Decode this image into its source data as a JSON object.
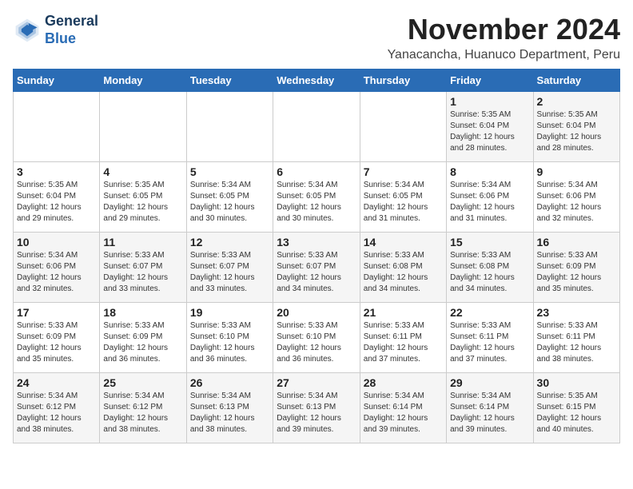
{
  "header": {
    "logo_line1": "General",
    "logo_line2": "Blue",
    "month": "November 2024",
    "location": "Yanacancha, Huanuco Department, Peru"
  },
  "weekdays": [
    "Sunday",
    "Monday",
    "Tuesday",
    "Wednesday",
    "Thursday",
    "Friday",
    "Saturday"
  ],
  "weeks": [
    [
      {
        "day": "",
        "info": ""
      },
      {
        "day": "",
        "info": ""
      },
      {
        "day": "",
        "info": ""
      },
      {
        "day": "",
        "info": ""
      },
      {
        "day": "",
        "info": ""
      },
      {
        "day": "1",
        "info": "Sunrise: 5:35 AM\nSunset: 6:04 PM\nDaylight: 12 hours and 28 minutes."
      },
      {
        "day": "2",
        "info": "Sunrise: 5:35 AM\nSunset: 6:04 PM\nDaylight: 12 hours and 28 minutes."
      }
    ],
    [
      {
        "day": "3",
        "info": "Sunrise: 5:35 AM\nSunset: 6:04 PM\nDaylight: 12 hours and 29 minutes."
      },
      {
        "day": "4",
        "info": "Sunrise: 5:35 AM\nSunset: 6:05 PM\nDaylight: 12 hours and 29 minutes."
      },
      {
        "day": "5",
        "info": "Sunrise: 5:34 AM\nSunset: 6:05 PM\nDaylight: 12 hours and 30 minutes."
      },
      {
        "day": "6",
        "info": "Sunrise: 5:34 AM\nSunset: 6:05 PM\nDaylight: 12 hours and 30 minutes."
      },
      {
        "day": "7",
        "info": "Sunrise: 5:34 AM\nSunset: 6:05 PM\nDaylight: 12 hours and 31 minutes."
      },
      {
        "day": "8",
        "info": "Sunrise: 5:34 AM\nSunset: 6:06 PM\nDaylight: 12 hours and 31 minutes."
      },
      {
        "day": "9",
        "info": "Sunrise: 5:34 AM\nSunset: 6:06 PM\nDaylight: 12 hours and 32 minutes."
      }
    ],
    [
      {
        "day": "10",
        "info": "Sunrise: 5:34 AM\nSunset: 6:06 PM\nDaylight: 12 hours and 32 minutes."
      },
      {
        "day": "11",
        "info": "Sunrise: 5:33 AM\nSunset: 6:07 PM\nDaylight: 12 hours and 33 minutes."
      },
      {
        "day": "12",
        "info": "Sunrise: 5:33 AM\nSunset: 6:07 PM\nDaylight: 12 hours and 33 minutes."
      },
      {
        "day": "13",
        "info": "Sunrise: 5:33 AM\nSunset: 6:07 PM\nDaylight: 12 hours and 34 minutes."
      },
      {
        "day": "14",
        "info": "Sunrise: 5:33 AM\nSunset: 6:08 PM\nDaylight: 12 hours and 34 minutes."
      },
      {
        "day": "15",
        "info": "Sunrise: 5:33 AM\nSunset: 6:08 PM\nDaylight: 12 hours and 34 minutes."
      },
      {
        "day": "16",
        "info": "Sunrise: 5:33 AM\nSunset: 6:09 PM\nDaylight: 12 hours and 35 minutes."
      }
    ],
    [
      {
        "day": "17",
        "info": "Sunrise: 5:33 AM\nSunset: 6:09 PM\nDaylight: 12 hours and 35 minutes."
      },
      {
        "day": "18",
        "info": "Sunrise: 5:33 AM\nSunset: 6:09 PM\nDaylight: 12 hours and 36 minutes."
      },
      {
        "day": "19",
        "info": "Sunrise: 5:33 AM\nSunset: 6:10 PM\nDaylight: 12 hours and 36 minutes."
      },
      {
        "day": "20",
        "info": "Sunrise: 5:33 AM\nSunset: 6:10 PM\nDaylight: 12 hours and 36 minutes."
      },
      {
        "day": "21",
        "info": "Sunrise: 5:33 AM\nSunset: 6:11 PM\nDaylight: 12 hours and 37 minutes."
      },
      {
        "day": "22",
        "info": "Sunrise: 5:33 AM\nSunset: 6:11 PM\nDaylight: 12 hours and 37 minutes."
      },
      {
        "day": "23",
        "info": "Sunrise: 5:33 AM\nSunset: 6:11 PM\nDaylight: 12 hours and 38 minutes."
      }
    ],
    [
      {
        "day": "24",
        "info": "Sunrise: 5:34 AM\nSunset: 6:12 PM\nDaylight: 12 hours and 38 minutes."
      },
      {
        "day": "25",
        "info": "Sunrise: 5:34 AM\nSunset: 6:12 PM\nDaylight: 12 hours and 38 minutes."
      },
      {
        "day": "26",
        "info": "Sunrise: 5:34 AM\nSunset: 6:13 PM\nDaylight: 12 hours and 38 minutes."
      },
      {
        "day": "27",
        "info": "Sunrise: 5:34 AM\nSunset: 6:13 PM\nDaylight: 12 hours and 39 minutes."
      },
      {
        "day": "28",
        "info": "Sunrise: 5:34 AM\nSunset: 6:14 PM\nDaylight: 12 hours and 39 minutes."
      },
      {
        "day": "29",
        "info": "Sunrise: 5:34 AM\nSunset: 6:14 PM\nDaylight: 12 hours and 39 minutes."
      },
      {
        "day": "30",
        "info": "Sunrise: 5:35 AM\nSunset: 6:15 PM\nDaylight: 12 hours and 40 minutes."
      }
    ]
  ]
}
